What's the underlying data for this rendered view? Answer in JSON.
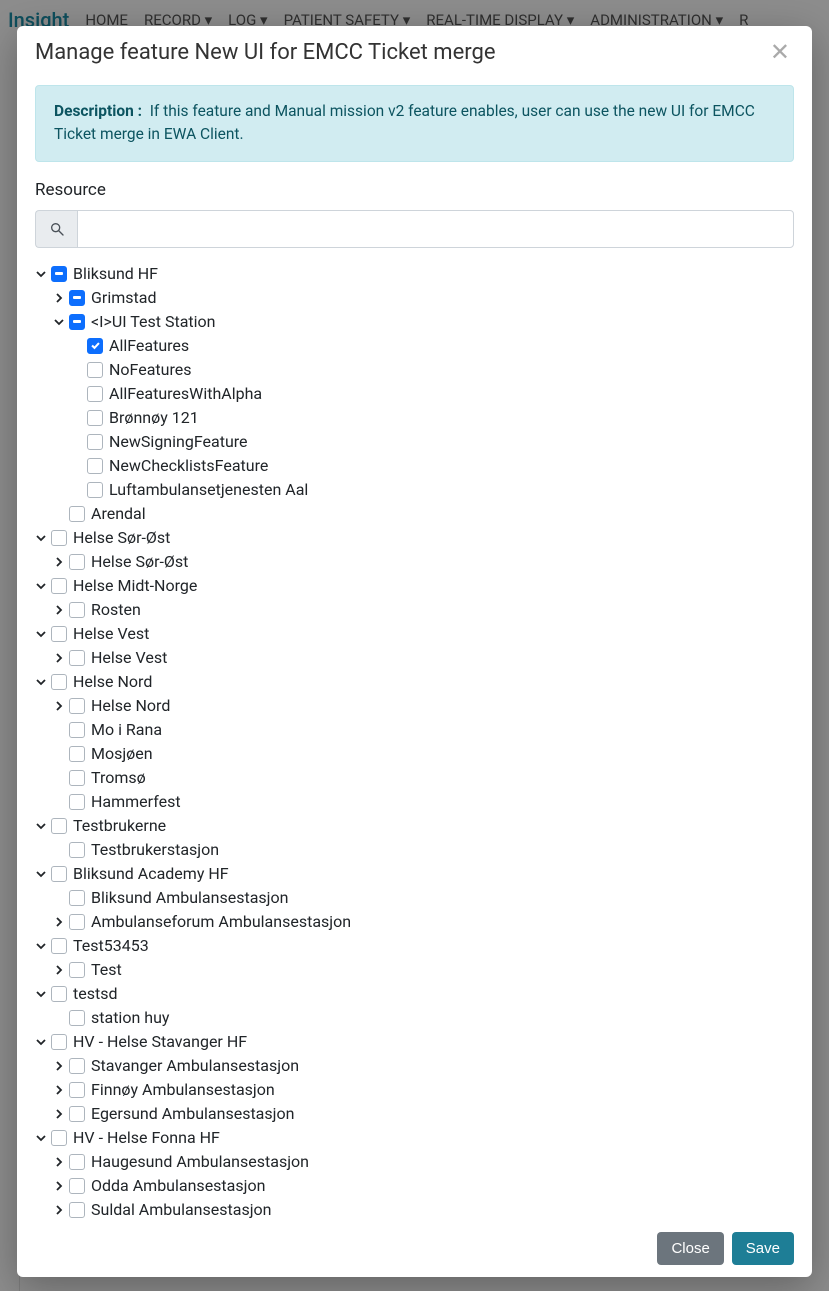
{
  "nav": {
    "brand": "Insight",
    "items": [
      "HOME",
      "RECORD",
      "LOG",
      "PATIENT SAFETY",
      "REAL-TIME DISPLAY",
      "ADMINISTRATION",
      "R"
    ]
  },
  "modal": {
    "title": "Manage feature New UI for EMCC Ticket merge",
    "description_label": "Description :",
    "description_text": "If this feature and Manual mission v2 feature enables, user can use the new UI for EMCC Ticket merge in EWA Client.",
    "resource_label": "Resource",
    "search_placeholder": "",
    "close_label": "Close",
    "save_label": "Save"
  },
  "tree": [
    {
      "label": "Bliksund HF",
      "state": "partial",
      "toggle": "down",
      "children": [
        {
          "label": "Grimstad",
          "state": "partial",
          "toggle": "right"
        },
        {
          "label": "<I>UI Test Station",
          "state": "partial",
          "toggle": "down",
          "children": [
            {
              "label": "AllFeatures",
              "state": "checked"
            },
            {
              "label": "NoFeatures",
              "state": "off"
            },
            {
              "label": "AllFeaturesWithAlpha",
              "state": "off"
            },
            {
              "label": "Brønnøy 121",
              "state": "off"
            },
            {
              "label": "NewSigningFeature",
              "state": "off"
            },
            {
              "label": "NewChecklistsFeature",
              "state": "off"
            },
            {
              "label": "Luftambulansetjenesten Aal",
              "state": "off"
            }
          ]
        },
        {
          "label": "Arendal",
          "state": "off"
        }
      ]
    },
    {
      "label": "Helse Sør-Øst",
      "state": "off",
      "toggle": "down",
      "children": [
        {
          "label": "Helse Sør-Øst",
          "state": "off",
          "toggle": "right"
        }
      ]
    },
    {
      "label": "Helse Midt-Norge",
      "state": "off",
      "toggle": "down",
      "children": [
        {
          "label": "Rosten",
          "state": "off",
          "toggle": "right"
        }
      ]
    },
    {
      "label": "Helse Vest",
      "state": "off",
      "toggle": "down",
      "children": [
        {
          "label": "Helse Vest",
          "state": "off",
          "toggle": "right"
        }
      ]
    },
    {
      "label": "Helse Nord",
      "state": "off",
      "toggle": "down",
      "children": [
        {
          "label": "Helse Nord",
          "state": "off",
          "toggle": "right"
        },
        {
          "label": "Mo i Rana",
          "state": "off"
        },
        {
          "label": "Mosjøen",
          "state": "off"
        },
        {
          "label": "Tromsø",
          "state": "off"
        },
        {
          "label": "Hammerfest",
          "state": "off"
        }
      ]
    },
    {
      "label": "Testbrukerne",
      "state": "off",
      "toggle": "down",
      "children": [
        {
          "label": "Testbrukerstasjon",
          "state": "off"
        }
      ]
    },
    {
      "label": "Bliksund Academy HF",
      "state": "off",
      "toggle": "down",
      "children": [
        {
          "label": "Bliksund Ambulansestasjon",
          "state": "off"
        },
        {
          "label": "Ambulanseforum Ambulansestasjon",
          "state": "off",
          "toggle": "right"
        }
      ]
    },
    {
      "label": "Test53453",
      "state": "off",
      "toggle": "down",
      "children": [
        {
          "label": "Test",
          "state": "off",
          "toggle": "right"
        }
      ]
    },
    {
      "label": "testsd",
      "state": "off",
      "toggle": "down",
      "children": [
        {
          "label": "station huy",
          "state": "off"
        }
      ]
    },
    {
      "label": "HV - Helse Stavanger HF",
      "state": "off",
      "toggle": "down",
      "children": [
        {
          "label": "Stavanger Ambulansestasjon",
          "state": "off",
          "toggle": "right"
        },
        {
          "label": "Finnøy Ambulansestasjon",
          "state": "off",
          "toggle": "right"
        },
        {
          "label": "Egersund Ambulansestasjon",
          "state": "off",
          "toggle": "right"
        }
      ]
    },
    {
      "label": "HV - Helse Fonna HF",
      "state": "off",
      "toggle": "down",
      "children": [
        {
          "label": "Haugesund Ambulansestasjon",
          "state": "off",
          "toggle": "right"
        },
        {
          "label": "Odda Ambulansestasjon",
          "state": "off",
          "toggle": "right"
        },
        {
          "label": "Suldal Ambulansestasjon",
          "state": "off",
          "toggle": "right"
        }
      ]
    }
  ]
}
